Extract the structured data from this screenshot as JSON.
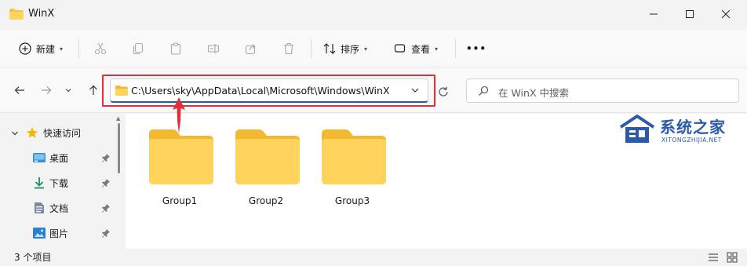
{
  "window": {
    "title": "WinX"
  },
  "toolbar": {
    "new_label": "新建",
    "sort_label": "排序",
    "view_label": "查看",
    "more_label": "•••"
  },
  "address": {
    "path": "C:\\Users\\sky\\AppData\\Local\\Microsoft\\Windows\\WinX"
  },
  "search": {
    "placeholder": "在 WinX 中搜索"
  },
  "sidebar": {
    "items": [
      {
        "label": "快速访问",
        "icon": "star-icon",
        "pinned": false
      },
      {
        "label": "桌面",
        "icon": "desktop-icon",
        "pinned": true
      },
      {
        "label": "下载",
        "icon": "download-icon",
        "pinned": true
      },
      {
        "label": "文档",
        "icon": "document-icon",
        "pinned": true
      },
      {
        "label": "图片",
        "icon": "picture-icon",
        "pinned": true
      }
    ]
  },
  "content": {
    "folders": [
      {
        "name": "Group1"
      },
      {
        "name": "Group2"
      },
      {
        "name": "Group3"
      }
    ]
  },
  "watermark": {
    "title": "系统之家",
    "subtitle": "XITONGZHIJIA.NET"
  },
  "status": {
    "item_count": "3 个项目"
  },
  "colors": {
    "highlight_red": "#e0313b",
    "folder_yellow": "#ffd35c",
    "accent_blue": "#1a5fb4"
  }
}
